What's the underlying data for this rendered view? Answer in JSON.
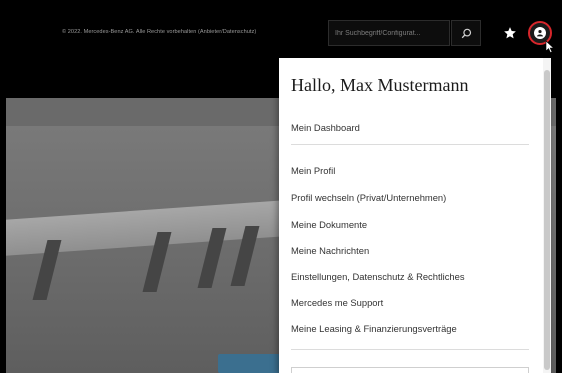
{
  "footer": {
    "copyright": "© 2022. Mercedes-Benz AG. Alle Rechte vorbehalten (Anbieter/Datenschutz)"
  },
  "header": {
    "search_placeholder": "Ihr Suchbegriff/Configurat..."
  },
  "user_menu": {
    "greeting": "Hallo, Max Mustermann",
    "items": [
      {
        "label": "Mein Dashboard"
      },
      {
        "label": "Mein Profil"
      },
      {
        "label": "Profil wechseln (Privat/Unternehmen)"
      },
      {
        "label": "Meine Dokumente"
      },
      {
        "label": "Meine Nachrichten"
      },
      {
        "label": "Einstellungen, Datenschutz & Rechtliches"
      },
      {
        "label": "Mercedes me Support"
      },
      {
        "label": "Meine Leasing & Finanzierungsverträge"
      }
    ]
  },
  "colors": {
    "header_bg": "#000000",
    "highlight_ring": "#d7262b",
    "panel_bg": "#ffffff"
  }
}
